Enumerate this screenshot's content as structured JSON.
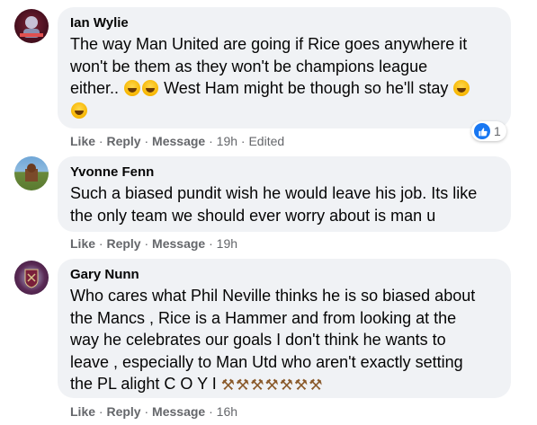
{
  "comments": [
    {
      "author": "Ian Wylie",
      "line1": "The way Man United are going if Rice goes anywhere it",
      "line2": "won't be them as they won't be champions league",
      "line3": "either..",
      "line3b": "West Ham might be though so he'll stay",
      "actions": {
        "like": "Like",
        "reply": "Reply",
        "message": "Message",
        "time": "19h",
        "edited": "Edited"
      },
      "reaction_count": "1"
    },
    {
      "author": "Yvonne Fenn",
      "line1": "Such a biased pundit wish he would leave his job. Its like",
      "line2": "the only team we should ever worry about is man u",
      "actions": {
        "like": "Like",
        "reply": "Reply",
        "message": "Message",
        "time": "19h"
      }
    },
    {
      "author": "Gary Nunn",
      "line1": "Who cares what Phil Neville thinks he is so biased about",
      "line2": "the Mancs , Rice is a Hammer and from looking at the",
      "line3": "way he celebrates our goals I don't think he wants to",
      "line4": "leave , especially to Man Utd who aren't exactly setting",
      "line5": "the PL alight C O Y I",
      "actions": {
        "like": "Like",
        "reply": "Reply",
        "message": "Message",
        "time": "16h"
      }
    }
  ],
  "colors": {
    "bubble": "#f0f2f5",
    "meta": "#65676b",
    "like_blue": "#1877f2"
  },
  "icons": {
    "laugh": "rolling-on-floor-laughing-emoji",
    "hammers": "crossed-hammers-emoji",
    "like": "thumbs-up-icon"
  }
}
